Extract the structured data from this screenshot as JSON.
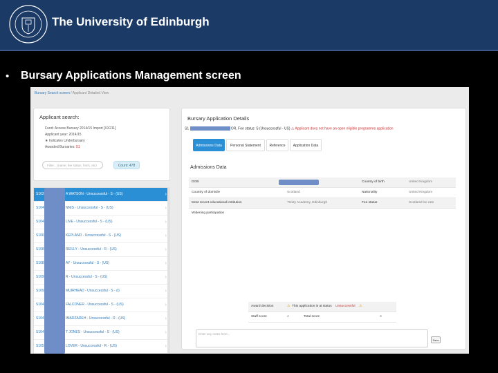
{
  "banner": {
    "title": "The University of Edinburgh",
    "crest_text": "THE UNIVERSITY of EDINBURGH",
    "background": "#1b3a66"
  },
  "slide": {
    "bullet": "•",
    "title": "Bursary Applications Management screen"
  },
  "screen": {
    "breadcrumb": {
      "root": "Bursary Search screen",
      "separator": "/",
      "current": "Applicant Detailed View"
    },
    "search_panel": {
      "title": "Applicant search:",
      "fund": "Fund: Access Bursary 2014/15 Import [XX211]",
      "year": "Applicant year: 2014/15",
      "star_label": "★ Indicates Underbursary",
      "awarded": "Awarded Bursaries:",
      "awarded_count": "51",
      "filter_placeholder": "Filter... (name, fee status, hm/s, etc)",
      "count_label": "Count: 478"
    },
    "applicant_list": [
      {
        "id": "S103",
        "name": "A WATSON - Unsuccessful - S - (US)"
      },
      {
        "id": "S104",
        "name": "NNIS - Unsuccessful - S - (US)"
      },
      {
        "id": "S104",
        "name": "LIVE - Unsuccessful - S - (US)"
      },
      {
        "id": "S106",
        "name": "KEPLAND - Unsuccessful - S - (US)"
      },
      {
        "id": "S108",
        "name": "REILLY - Unsuccessful - R - (US)"
      },
      {
        "id": "S108",
        "name": "AY - Unsuccessful - S - (US)"
      },
      {
        "id": "S109",
        "name": "R - Unsuccessful - S - (US)"
      },
      {
        "id": "S109",
        "name": "MUIRHEAD - Unsuccessful - S - (I)"
      },
      {
        "id": "S104",
        "name": "FALCONER - Unsuccessful - S - (US)"
      },
      {
        "id": "S104",
        "name": "IMADZADEH - Unsuccessful - R - (US)"
      },
      {
        "id": "S104",
        "name": "T JONES - Unsuccessful - S - (US)"
      },
      {
        "id": "S105",
        "name": "LOVER - Unsuccessful - R - (US)"
      }
    ],
    "details": {
      "title": "Bursary Application Details",
      "sub_id": "S1",
      "sub_status": "OR, Fee status: S (Unsuccessful - US)",
      "sub_error": "Applicant does not have an open eligible programme application",
      "tabs": [
        "Admissions Data",
        "Personal Statement",
        "Reference",
        "Application Data"
      ],
      "section_title": "Admissions Data",
      "rows": [
        {
          "label": "DOB",
          "value": "",
          "label2": "Country of birth",
          "value2": "United Kingdom"
        },
        {
          "label": "Country of domicile",
          "value": "Scotland",
          "label2": "Nationality",
          "value2": "United Kingdom"
        },
        {
          "label": "Most recent educational institution",
          "value": "Trinity Academy, Edinburgh",
          "label2": "Fee status",
          "value2": "Scotland fee rate"
        },
        {
          "label": "Widening participation",
          "value": "",
          "label2": "",
          "value2": ""
        }
      ],
      "award": {
        "decision_label": "Award decision",
        "decision_prefix": "This application is at status",
        "decision_status": "Unsuccessful",
        "staff_label": "Staff score",
        "staff_value": "4",
        "total_label": "Total score",
        "total_value": "3"
      },
      "notes_placeholder": "Enter any notes here...",
      "save_label": "Save"
    }
  }
}
